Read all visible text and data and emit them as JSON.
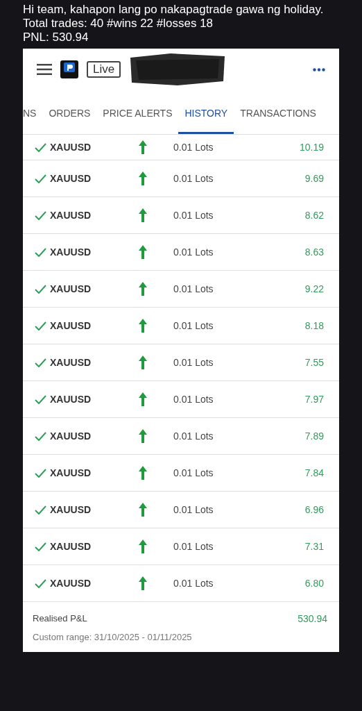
{
  "message": {
    "lines": [
      "Hi team, kahapon lang po nakapagtrade gawa ng holiday.",
      "Total trades: 40 #wins 22 #losses 18",
      "PNL:  530.94"
    ]
  },
  "app": {
    "account_badge": "Live",
    "tabs": [
      {
        "label": "NS",
        "selected": false
      },
      {
        "label": "ORDERS",
        "selected": false
      },
      {
        "label": "PRICE ALERTS",
        "selected": false
      },
      {
        "label": "HISTORY",
        "selected": true
      },
      {
        "label": "TRANSACTIONS",
        "selected": false
      }
    ],
    "trades": [
      {
        "symbol": "XAUUSD",
        "lots": "0.01 Lots",
        "value": "10.19"
      },
      {
        "symbol": "XAUUSD",
        "lots": "0.01 Lots",
        "value": "9.69"
      },
      {
        "symbol": "XAUUSD",
        "lots": "0.01 Lots",
        "value": "8.62"
      },
      {
        "symbol": "XAUUSD",
        "lots": "0.01 Lots",
        "value": "8.63"
      },
      {
        "symbol": "XAUUSD",
        "lots": "0.01 Lots",
        "value": "9.22"
      },
      {
        "symbol": "XAUUSD",
        "lots": "0.01 Lots",
        "value": "8.18"
      },
      {
        "symbol": "XAUUSD",
        "lots": "0.01 Lots",
        "value": "7.55"
      },
      {
        "symbol": "XAUUSD",
        "lots": "0.01 Lots",
        "value": "7.97"
      },
      {
        "symbol": "XAUUSD",
        "lots": "0.01 Lots",
        "value": "7.89"
      },
      {
        "symbol": "XAUUSD",
        "lots": "0.01 Lots",
        "value": "7.84"
      },
      {
        "symbol": "XAUUSD",
        "lots": "0.01 Lots",
        "value": "6.96"
      },
      {
        "symbol": "XAUUSD",
        "lots": "0.01 Lots",
        "value": "7.31"
      },
      {
        "symbol": "XAUUSD",
        "lots": "0.01 Lots",
        "value": "6.80"
      }
    ],
    "summary": {
      "label": "Realised P&L",
      "value": "530.94",
      "range": "Custom range: 31/10/2025 - 01/11/2025"
    }
  }
}
